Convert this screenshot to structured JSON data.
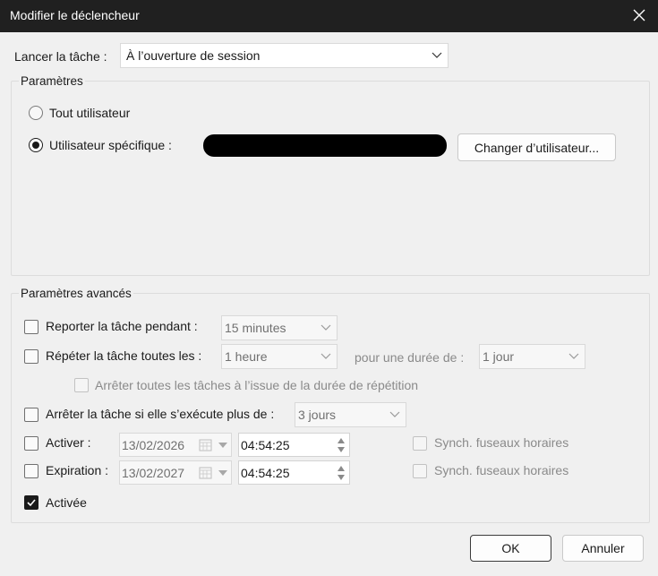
{
  "window": {
    "title": "Modifier le déclencheur",
    "close_icon": "close-icon"
  },
  "trigger": {
    "label": "Lancer la tâche :",
    "value": "À l’ouverture de session"
  },
  "settings": {
    "title": "Paramètres",
    "any_user_label": "Tout utilisateur",
    "specific_user_label": "Utilisateur spécifique :",
    "selected": "specific",
    "change_user_button": "Changer d’utilisateur..."
  },
  "advanced": {
    "title": "Paramètres avancés",
    "delay": {
      "label": "Reporter la tâche pendant :",
      "value": "15 minutes",
      "checked": false
    },
    "repeat": {
      "label": "Répéter la tâche toutes les :",
      "value": "1 heure",
      "checked": false,
      "duration_label": "pour une durée de :",
      "duration_value": "1 jour",
      "stop_all_label": "Arrêter toutes les tâches à l’issue de la durée de répétition"
    },
    "stop_if_longer": {
      "label": "Arrêter la tâche si elle s’exécute plus de :",
      "value": "3 jours",
      "checked": false
    },
    "activate": {
      "label": "Activer :",
      "date": "13/02/2026",
      "time": "04:54:25",
      "sync_label": "Synch. fuseaux horaires"
    },
    "expiration": {
      "label": "Expiration :",
      "date": "13/02/2027",
      "time": "04:54:25",
      "sync_label": "Synch. fuseaux horaires"
    },
    "enabled": {
      "label": "Activée",
      "checked": true
    }
  },
  "buttons": {
    "ok": "OK",
    "cancel": "Annuler"
  },
  "colors": {
    "titlebar": "#202020",
    "dialog_bg": "#f0f0f0",
    "text": "#1a1a1a",
    "disabled_text": "#8a8a8a"
  }
}
